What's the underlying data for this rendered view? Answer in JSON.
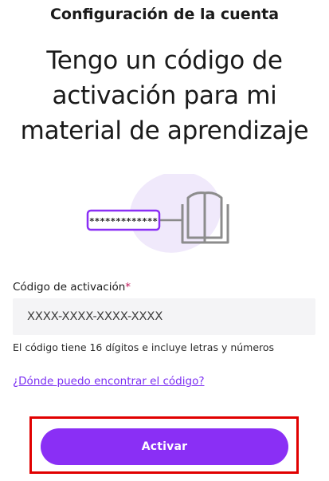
{
  "header": {
    "title": "Configuración de la cuenta"
  },
  "hero": {
    "line1": "Tengo un código de",
    "line2": "activación para mi",
    "line3": "material de aprendizaje"
  },
  "illustration": {
    "mask_text": "*************",
    "book_icon": "open-book-icon"
  },
  "form": {
    "label": "Código de activación",
    "required_mark": "*",
    "placeholder": "XXXX-XXXX-XXXX-XXXX",
    "value": "",
    "helper": "El código tiene 16 dígitos e incluye letras y números"
  },
  "help_link": "¿Dónde puedo encontrar el código?",
  "cta": {
    "label": "Activar"
  },
  "colors": {
    "accent": "#8a2ff5",
    "link": "#7b2ff2",
    "required": "#c2185b",
    "highlight_frame": "#e10000"
  }
}
